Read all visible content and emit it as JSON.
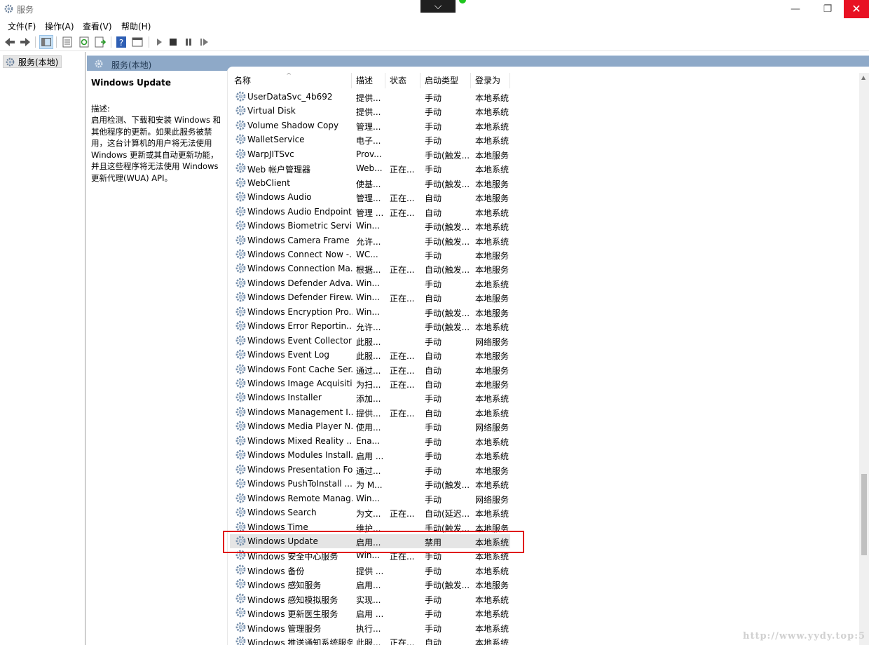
{
  "window": {
    "title": "服务",
    "collapse_glyph": "⌵",
    "min_glyph": "—",
    "max_glyph": "❐",
    "close_glyph": "✕"
  },
  "menu": [
    "文件(F)",
    "操作(A)",
    "查看(V)",
    "帮助(H)"
  ],
  "tree": {
    "root_label": "服务(本地)"
  },
  "panel": {
    "header_title": "服务(本地)"
  },
  "description": {
    "service_name": "Windows Update",
    "label": "描述:",
    "text": "启用检测、下载和安装 Windows 和其他程序的更新。如果此服务被禁用，这台计算机的用户将无法使用 Windows 更新或其自动更新功能，并且这些程序将无法使用 Windows 更新代理(WUA) API。"
  },
  "columns": [
    "名称",
    "描述",
    "状态",
    "启动类型",
    "登录为"
  ],
  "rows": [
    {
      "name": "UserDataSvc_4b692",
      "desc": "提供...",
      "status": "",
      "startup": "手动",
      "logon": "本地系统"
    },
    {
      "name": "Virtual Disk",
      "desc": "提供...",
      "status": "",
      "startup": "手动",
      "logon": "本地系统"
    },
    {
      "name": "Volume Shadow Copy",
      "desc": "管理...",
      "status": "",
      "startup": "手动",
      "logon": "本地系统"
    },
    {
      "name": "WalletService",
      "desc": "电子...",
      "status": "",
      "startup": "手动",
      "logon": "本地系统"
    },
    {
      "name": "WarpJITSvc",
      "desc": "Prov...",
      "status": "",
      "startup": "手动(触发...",
      "logon": "本地服务"
    },
    {
      "name": "Web 帐户管理器",
      "desc": "Web...",
      "status": "正在...",
      "startup": "手动",
      "logon": "本地系统"
    },
    {
      "name": "WebClient",
      "desc": "使基...",
      "status": "",
      "startup": "手动(触发...",
      "logon": "本地服务"
    },
    {
      "name": "Windows Audio",
      "desc": "管理...",
      "status": "正在...",
      "startup": "自动",
      "logon": "本地服务"
    },
    {
      "name": "Windows Audio Endpoint...",
      "desc": "管理 ...",
      "status": "正在...",
      "startup": "自动",
      "logon": "本地系统"
    },
    {
      "name": "Windows Biometric Servi...",
      "desc": "Win...",
      "status": "",
      "startup": "手动(触发...",
      "logon": "本地系统"
    },
    {
      "name": "Windows Camera Frame ...",
      "desc": "允许...",
      "status": "",
      "startup": "手动(触发...",
      "logon": "本地系统"
    },
    {
      "name": "Windows Connect Now -...",
      "desc": "WC...",
      "status": "",
      "startup": "手动",
      "logon": "本地服务"
    },
    {
      "name": "Windows Connection Ma...",
      "desc": "根据...",
      "status": "正在...",
      "startup": "自动(触发...",
      "logon": "本地服务"
    },
    {
      "name": "Windows Defender Adva...",
      "desc": "Win...",
      "status": "",
      "startup": "手动",
      "logon": "本地系统"
    },
    {
      "name": "Windows Defender Firew...",
      "desc": "Win...",
      "status": "正在...",
      "startup": "自动",
      "logon": "本地服务"
    },
    {
      "name": "Windows Encryption Pro...",
      "desc": "Win...",
      "status": "",
      "startup": "手动(触发...",
      "logon": "本地服务"
    },
    {
      "name": "Windows Error Reportin...",
      "desc": "允许...",
      "status": "",
      "startup": "手动(触发...",
      "logon": "本地系统"
    },
    {
      "name": "Windows Event Collector",
      "desc": "此服...",
      "status": "",
      "startup": "手动",
      "logon": "网络服务"
    },
    {
      "name": "Windows Event Log",
      "desc": "此服...",
      "status": "正在...",
      "startup": "自动",
      "logon": "本地服务"
    },
    {
      "name": "Windows Font Cache Ser...",
      "desc": "通过...",
      "status": "正在...",
      "startup": "自动",
      "logon": "本地服务"
    },
    {
      "name": "Windows Image Acquisiti...",
      "desc": "为扫...",
      "status": "正在...",
      "startup": "自动",
      "logon": "本地服务"
    },
    {
      "name": "Windows Installer",
      "desc": "添加...",
      "status": "",
      "startup": "手动",
      "logon": "本地系统"
    },
    {
      "name": "Windows Management I...",
      "desc": "提供...",
      "status": "正在...",
      "startup": "自动",
      "logon": "本地系统"
    },
    {
      "name": "Windows Media Player N...",
      "desc": "使用...",
      "status": "",
      "startup": "手动",
      "logon": "网络服务"
    },
    {
      "name": "Windows Mixed Reality ...",
      "desc": "Ena...",
      "status": "",
      "startup": "手动",
      "logon": "本地系统"
    },
    {
      "name": "Windows Modules Install...",
      "desc": "启用 ...",
      "status": "",
      "startup": "手动",
      "logon": "本地系统"
    },
    {
      "name": "Windows Presentation Fo...",
      "desc": "通过...",
      "status": "",
      "startup": "手动",
      "logon": "本地服务"
    },
    {
      "name": "Windows PushToInstall ...",
      "desc": "为 M...",
      "status": "",
      "startup": "手动(触发...",
      "logon": "本地系统"
    },
    {
      "name": "Windows Remote Manag...",
      "desc": "Win...",
      "status": "",
      "startup": "手动",
      "logon": "网络服务"
    },
    {
      "name": "Windows Search",
      "desc": "为文...",
      "status": "正在...",
      "startup": "自动(延迟...",
      "logon": "本地系统"
    },
    {
      "name": "Windows Time",
      "desc": "维护...",
      "status": "",
      "startup": "手动(触发...",
      "logon": "本地服务"
    },
    {
      "name": "Windows Update",
      "desc": "启用...",
      "status": "",
      "startup": "禁用",
      "logon": "本地系统",
      "selected": true
    },
    {
      "name": "Windows 安全中心服务",
      "desc": "Win...",
      "status": "正在...",
      "startup": "手动",
      "logon": "本地系统"
    },
    {
      "name": "Windows 备份",
      "desc": "提供 ...",
      "status": "",
      "startup": "手动",
      "logon": "本地系统"
    },
    {
      "name": "Windows 感知服务",
      "desc": "启用...",
      "status": "",
      "startup": "手动(触发...",
      "logon": "本地服务"
    },
    {
      "name": "Windows 感知模拟服务",
      "desc": "实现...",
      "status": "",
      "startup": "手动",
      "logon": "本地系统"
    },
    {
      "name": "Windows 更新医生服务",
      "desc": "启用 ...",
      "status": "",
      "startup": "手动",
      "logon": "本地系统"
    },
    {
      "name": "Windows 管理服务",
      "desc": "执行...",
      "status": "",
      "startup": "手动",
      "logon": "本地系统"
    },
    {
      "name": "Windows 推送通知系统服务",
      "desc": "此服...",
      "status": "正在...",
      "startup": "自动",
      "logon": "本地系统"
    }
  ],
  "watermark": "http://www.yydy.top:5",
  "colors": {
    "header_bar": "#8ea9c8",
    "highlight": "#e01010",
    "close": "#e81123",
    "selected_row": "#e5e5e5"
  }
}
